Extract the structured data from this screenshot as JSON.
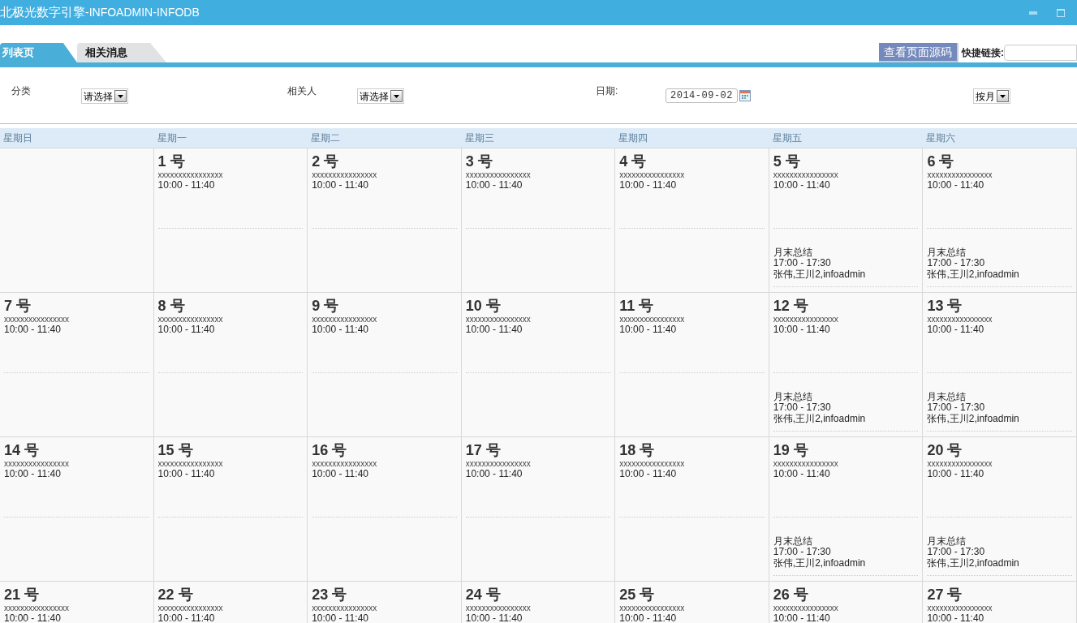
{
  "window": {
    "title": "北极光数字引擎",
    "subtitle": "-INFOADMIN-INFODB"
  },
  "tabs": [
    {
      "label": "列表页",
      "selected": true
    },
    {
      "label": "相关消息",
      "selected": false
    }
  ],
  "toolbar": {
    "button": "查看页面源码",
    "link_label": "快捷链接:"
  },
  "filters": [
    {
      "kind": "select",
      "label": "分类",
      "value": "请选择"
    },
    {
      "kind": "select",
      "label": "相关人",
      "value": "请选择"
    },
    {
      "kind": "date",
      "label": "日期:",
      "value": "2014-09-02"
    },
    {
      "kind": "select",
      "value": "按月"
    }
  ],
  "weekdays": [
    "星期日",
    "星期一",
    "星期二",
    "星期三",
    "星期四",
    "星期五",
    "星期六"
  ],
  "weeks": [
    [
      {
        "kind": "empty"
      },
      {
        "kind": "day",
        "label": "1 号",
        "events": [
          {
            "title": "xxxxxxxxxxxxxxxx",
            "time": "10:00 - 11:40"
          }
        ]
      },
      {
        "kind": "day",
        "label": "2 号",
        "events": [
          {
            "title": "xxxxxxxxxxxxxxxx",
            "time": "10:00 - 11:40"
          }
        ]
      },
      {
        "kind": "day",
        "label": "3 号",
        "events": [
          {
            "title": "xxxxxxxxxxxxxxxx",
            "time": "10:00 - 11:40"
          }
        ]
      },
      {
        "kind": "day",
        "label": "4 号",
        "events": [
          {
            "title": "xxxxxxxxxxxxxxxx",
            "time": "10:00 - 11:40"
          }
        ]
      },
      {
        "kind": "day",
        "label": "5 号",
        "events": [
          {
            "title": "xxxxxxxxxxxxxxxx",
            "time": "10:00 - 11:40"
          },
          {
            "title": "月末总结",
            "time": "17:00 - 17:30",
            "people": "张伟,王川2,infoadmin"
          }
        ]
      },
      {
        "kind": "day",
        "label": "6 号",
        "events": [
          {
            "title": "xxxxxxxxxxxxxxxx",
            "time": "10:00 - 11:40"
          },
          {
            "title": "月末总结",
            "time": "17:00 - 17:30",
            "people": "张伟,王川2,infoadmin"
          }
        ]
      }
    ],
    [
      {
        "kind": "day",
        "label": "7 号",
        "events": [
          {
            "title": "xxxxxxxxxxxxxxxx",
            "time": "10:00 - 11:40"
          }
        ]
      },
      {
        "kind": "day",
        "label": "8 号",
        "events": [
          {
            "title": "xxxxxxxxxxxxxxxx",
            "time": "10:00 - 11:40"
          }
        ]
      },
      {
        "kind": "day",
        "label": "9 号",
        "events": [
          {
            "title": "xxxxxxxxxxxxxxxx",
            "time": "10:00 - 11:40"
          }
        ]
      },
      {
        "kind": "day",
        "label": "10 号",
        "events": [
          {
            "title": "xxxxxxxxxxxxxxxx",
            "time": "10:00 - 11:40"
          }
        ]
      },
      {
        "kind": "day",
        "label": "11 号",
        "events": [
          {
            "title": "xxxxxxxxxxxxxxxx",
            "time": "10:00 - 11:40"
          }
        ]
      },
      {
        "kind": "day",
        "label": "12 号",
        "events": [
          {
            "title": "xxxxxxxxxxxxxxxx",
            "time": "10:00 - 11:40"
          },
          {
            "title": "月末总结",
            "time": "17:00 - 17:30",
            "people": "张伟,王川2,infoadmin"
          }
        ]
      },
      {
        "kind": "day",
        "label": "13 号",
        "events": [
          {
            "title": "xxxxxxxxxxxxxxxx",
            "time": "10:00 - 11:40"
          },
          {
            "title": "月末总结",
            "time": "17:00 - 17:30",
            "people": "张伟,王川2,infoadmin"
          }
        ]
      }
    ],
    [
      {
        "kind": "day",
        "label": "14 号",
        "events": [
          {
            "title": "xxxxxxxxxxxxxxxx",
            "time": "10:00 - 11:40"
          }
        ]
      },
      {
        "kind": "day",
        "label": "15 号",
        "events": [
          {
            "title": "xxxxxxxxxxxxxxxx",
            "time": "10:00 - 11:40"
          }
        ]
      },
      {
        "kind": "day",
        "label": "16 号",
        "events": [
          {
            "title": "xxxxxxxxxxxxxxxx",
            "time": "10:00 - 11:40"
          }
        ]
      },
      {
        "kind": "day",
        "label": "17 号",
        "events": [
          {
            "title": "xxxxxxxxxxxxxxxx",
            "time": "10:00 - 11:40"
          }
        ]
      },
      {
        "kind": "day",
        "label": "18 号",
        "events": [
          {
            "title": "xxxxxxxxxxxxxxxx",
            "time": "10:00 - 11:40"
          }
        ]
      },
      {
        "kind": "day",
        "label": "19 号",
        "events": [
          {
            "title": "xxxxxxxxxxxxxxxx",
            "time": "10:00 - 11:40"
          },
          {
            "title": "月末总结",
            "time": "17:00 - 17:30",
            "people": "张伟,王川2,infoadmin"
          }
        ]
      },
      {
        "kind": "day",
        "label": "20 号",
        "events": [
          {
            "title": "xxxxxxxxxxxxxxxx",
            "time": "10:00 - 11:40"
          },
          {
            "title": "月末总结",
            "time": "17:00 - 17:30",
            "people": "张伟,王川2,infoadmin"
          }
        ]
      }
    ],
    [
      {
        "kind": "day",
        "label": "21 号",
        "events": [
          {
            "title": "xxxxxxxxxxxxxxxx",
            "time": "10:00 - 11:40"
          }
        ]
      },
      {
        "kind": "day",
        "label": "22 号",
        "events": [
          {
            "title": "xxxxxxxxxxxxxxxx",
            "time": "10:00 - 11:40"
          }
        ]
      },
      {
        "kind": "day",
        "label": "23 号",
        "events": [
          {
            "title": "xxxxxxxxxxxxxxxx",
            "time": "10:00 - 11:40"
          }
        ]
      },
      {
        "kind": "day",
        "label": "24 号",
        "events": [
          {
            "title": "xxxxxxxxxxxxxxxx",
            "time": "10:00 - 11:40"
          }
        ]
      },
      {
        "kind": "day",
        "label": "25 号",
        "events": [
          {
            "title": "xxxxxxxxxxxxxxxx",
            "time": "10:00 - 11:40"
          }
        ]
      },
      {
        "kind": "day",
        "label": "26 号",
        "events": [
          {
            "title": "xxxxxxxxxxxxxxxx",
            "time": "10:00 - 11:40"
          }
        ]
      },
      {
        "kind": "day",
        "label": "27 号",
        "events": [
          {
            "title": "xxxxxxxxxxxxxxxx",
            "time": "10:00 - 11:40"
          }
        ]
      }
    ]
  ]
}
